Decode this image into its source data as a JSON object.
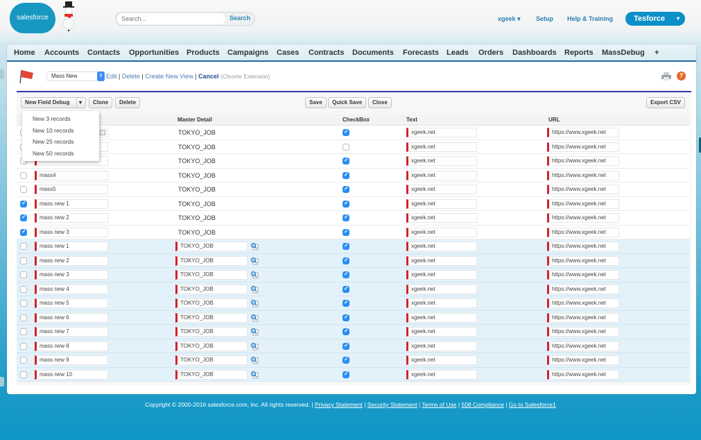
{
  "header": {
    "logo_text": "salesforce",
    "search_placeholder": "Search...",
    "search_button": "Search",
    "user_menu": "xgeek ▾",
    "setup": "Setup",
    "help": "Help & Training",
    "app_switcher": "Tesforce",
    "app_switcher_caret": "▾"
  },
  "tabs": [
    "Home",
    "Accounts",
    "Contacts",
    "Opportunities",
    "Products",
    "Campaigns",
    "Cases",
    "Contracts",
    "Documents",
    "Forecasts",
    "Leads",
    "Orders",
    "Dashboards",
    "Reports",
    "MassDebug",
    "+"
  ],
  "viewbar": {
    "selected_view": "Mass New",
    "edit": "Edit",
    "delete": "Delete",
    "create": "Create New View",
    "cancel": "Cancel",
    "note": "(Chrome Extension)",
    "help_glyph": "?"
  },
  "toolbar": {
    "new_field_debug": "New Field Debug",
    "dropdown_caret": "▾",
    "clone": "Clone",
    "delete": "Delete",
    "save": "Save",
    "quick_save": "Quick Save",
    "close": "Close",
    "export_csv": "Export CSV"
  },
  "new_menu": [
    "New 3 records",
    "New 10 records",
    "New 25 records",
    "New 50 records"
  ],
  "columns": {
    "master_detail": "Master Detail",
    "checkbox": "CheckBox",
    "text": "Text",
    "url": "URL"
  },
  "rows": [
    {
      "selected": false,
      "name": "",
      "master": "TOKYO_JOB",
      "editable_master": false,
      "checkbox": true,
      "text": "xgeek.net",
      "url": "https://www.xgeek.net",
      "new": false
    },
    {
      "selected": false,
      "name": "",
      "master": "TOKYO_JOB",
      "editable_master": false,
      "checkbox": false,
      "text": "xgeek.net",
      "url": "https://www.xgeek.net",
      "new": false
    },
    {
      "selected": false,
      "name": "",
      "master": "TOKYO_JOB",
      "editable_master": false,
      "checkbox": true,
      "text": "xgeek.net",
      "url": "https://www.xgeek.net",
      "new": false
    },
    {
      "selected": false,
      "name": "mass4",
      "master": "TOKYO_JOB",
      "editable_master": false,
      "checkbox": true,
      "text": "xgeek.net",
      "url": "https://www.xgeek.net",
      "new": false
    },
    {
      "selected": false,
      "name": "mass5",
      "master": "TOKYO_JOB",
      "editable_master": false,
      "checkbox": true,
      "text": "xgeek.net",
      "url": "https://www.xgeek.net",
      "new": false
    },
    {
      "selected": true,
      "name": "mass new 1",
      "master": "TOKYO_JOB",
      "editable_master": false,
      "checkbox": true,
      "text": "xgeek.net",
      "url": "https://www.xgeek.net",
      "new": false
    },
    {
      "selected": true,
      "name": "mass new 2",
      "master": "TOKYO_JOB",
      "editable_master": false,
      "checkbox": true,
      "text": "xgeek.net",
      "url": "https://www.xgeek.net",
      "new": false
    },
    {
      "selected": true,
      "name": "mass new 3",
      "master": "TOKYO_JOB",
      "editable_master": false,
      "checkbox": true,
      "text": "xgeek.net",
      "url": "https://www.xgeek.net",
      "new": false
    },
    {
      "selected": false,
      "name": "mass new 1",
      "master": "TOKYO_JOB",
      "editable_master": true,
      "checkbox": true,
      "text": "xgeek.net",
      "url": "https://www.xgeek.net",
      "new": true
    },
    {
      "selected": false,
      "name": "mass new 2",
      "master": "TOKYO_JOB",
      "editable_master": true,
      "checkbox": true,
      "text": "xgeek.net",
      "url": "https://www.xgeek.net",
      "new": true
    },
    {
      "selected": false,
      "name": "mass new 3",
      "master": "TOKYO_JOB",
      "editable_master": true,
      "checkbox": true,
      "text": "xgeek.net",
      "url": "https://www.xgeek.net",
      "new": true
    },
    {
      "selected": false,
      "name": "mass new 4",
      "master": "TOKYO_JOB",
      "editable_master": true,
      "checkbox": true,
      "text": "xgeek.net",
      "url": "https://www.xgeek.net",
      "new": true
    },
    {
      "selected": false,
      "name": "mass new 5",
      "master": "TOKYO_JOB",
      "editable_master": true,
      "checkbox": true,
      "text": "xgeek.net",
      "url": "https://www.xgeek.net",
      "new": true
    },
    {
      "selected": false,
      "name": "mass new 6",
      "master": "TOKYO_JOB",
      "editable_master": true,
      "checkbox": true,
      "text": "xgeek.net",
      "url": "https://www.xgeek.net",
      "new": true
    },
    {
      "selected": false,
      "name": "mass new 7",
      "master": "TOKYO_JOB",
      "editable_master": true,
      "checkbox": true,
      "text": "xgeek.net",
      "url": "https://www.xgeek.net",
      "new": true
    },
    {
      "selected": false,
      "name": "mass new 8",
      "master": "TOKYO_JOB",
      "editable_master": true,
      "checkbox": true,
      "text": "xgeek.net",
      "url": "https://www.xgeek.net",
      "new": true
    },
    {
      "selected": false,
      "name": "mass new 9",
      "master": "TOKYO_JOB",
      "editable_master": true,
      "checkbox": true,
      "text": "xgeek.net",
      "url": "https://www.xgeek.net",
      "new": true
    },
    {
      "selected": false,
      "name": "mass new 10",
      "master": "TOKYO_JOB",
      "editable_master": true,
      "checkbox": true,
      "text": "xgeek.net",
      "url": "https://www.xgeek.net",
      "new": true
    }
  ],
  "footer": {
    "copyright": "Copyright © 2000-2016 salesforce.com, inc. All rights reserved. |",
    "links": [
      "Privacy Statement",
      "Security Statement",
      "Terms of Use",
      "508 Compliance",
      "Go to Salesforce1"
    ]
  },
  "colors": {
    "brand": "#1798c1",
    "required_marker": "#d0222a",
    "tab_underline": "#1f67a8",
    "new_row_bg": "#e3f1fa",
    "checkbox_on": "#2a8ef0"
  }
}
